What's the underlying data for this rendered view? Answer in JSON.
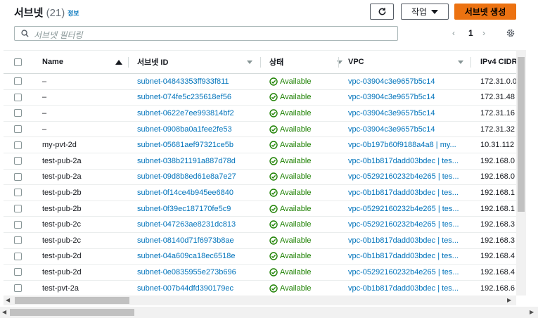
{
  "header": {
    "title": "서브넷",
    "count": "(21)",
    "info": "정보",
    "action_label": "작업",
    "create_label": "서브넷 생성"
  },
  "search": {
    "placeholder": "서브넷 필터링"
  },
  "pagination": {
    "prev": "‹",
    "current": "1",
    "next": "›"
  },
  "columns": [
    "Name",
    "서브넷 ID",
    "상태",
    "VPC",
    "IPv4 CIDR"
  ],
  "rows": [
    {
      "name": "–",
      "id": "subnet-04843353ff933f811",
      "state": "Available",
      "vpc": "vpc-03904c3e9657b5c14",
      "cidr": "172.31.0.0"
    },
    {
      "name": "–",
      "id": "subnet-074fe5c235618ef56",
      "state": "Available",
      "vpc": "vpc-03904c3e9657b5c14",
      "cidr": "172.31.48"
    },
    {
      "name": "–",
      "id": "subnet-0622e7ee993814bf2",
      "state": "Available",
      "vpc": "vpc-03904c3e9657b5c14",
      "cidr": "172.31.16"
    },
    {
      "name": "–",
      "id": "subnet-0908ba0a1fee2fe53",
      "state": "Available",
      "vpc": "vpc-03904c3e9657b5c14",
      "cidr": "172.31.32"
    },
    {
      "name": "my-pvt-2d",
      "id": "subnet-05681aef97321ce5b",
      "state": "Available",
      "vpc": "vpc-0b197b60f9188a4a8 | my...",
      "cidr": "10.31.112"
    },
    {
      "name": "test-pub-2a",
      "id": "subnet-038b21191a887d78d",
      "state": "Available",
      "vpc": "vpc-0b1b817dadd03bdec | tes...",
      "cidr": "192.168.0"
    },
    {
      "name": "test-pub-2a",
      "id": "subnet-09d8b8ed61e8a7e27",
      "state": "Available",
      "vpc": "vpc-05292160232b4e265 | tes...",
      "cidr": "192.168.0"
    },
    {
      "name": "test-pub-2b",
      "id": "subnet-0f14ce4b945ee6840",
      "state": "Available",
      "vpc": "vpc-0b1b817dadd03bdec | tes...",
      "cidr": "192.168.1"
    },
    {
      "name": "test-pub-2b",
      "id": "subnet-0f39ec187170fe5c9",
      "state": "Available",
      "vpc": "vpc-05292160232b4e265 | tes...",
      "cidr": "192.168.1"
    },
    {
      "name": "test-pub-2c",
      "id": "subnet-047263ae8231dc813",
      "state": "Available",
      "vpc": "vpc-05292160232b4e265 | tes...",
      "cidr": "192.168.3"
    },
    {
      "name": "test-pub-2c",
      "id": "subnet-08140d71f6973b8ae",
      "state": "Available",
      "vpc": "vpc-0b1b817dadd03bdec | tes...",
      "cidr": "192.168.3"
    },
    {
      "name": "test-pub-2d",
      "id": "subnet-04a609ca18ec6518e",
      "state": "Available",
      "vpc": "vpc-0b1b817dadd03bdec | tes...",
      "cidr": "192.168.4"
    },
    {
      "name": "test-pub-2d",
      "id": "subnet-0e0835955e273b696",
      "state": "Available",
      "vpc": "vpc-05292160232b4e265 | tes...",
      "cidr": "192.168.4"
    },
    {
      "name": "test-pvt-2a",
      "id": "subnet-007b44dfd390179ec",
      "state": "Available",
      "vpc": "vpc-0b1b817dadd03bdec | tes...",
      "cidr": "192.168.6"
    }
  ],
  "colors": {
    "accent": "#ec7211",
    "link": "#0073bb",
    "available": "#1d8102"
  },
  "icons": [
    "refresh-icon",
    "caret-down-icon",
    "search-icon",
    "settings-gear-icon",
    "status-ok-icon"
  ]
}
